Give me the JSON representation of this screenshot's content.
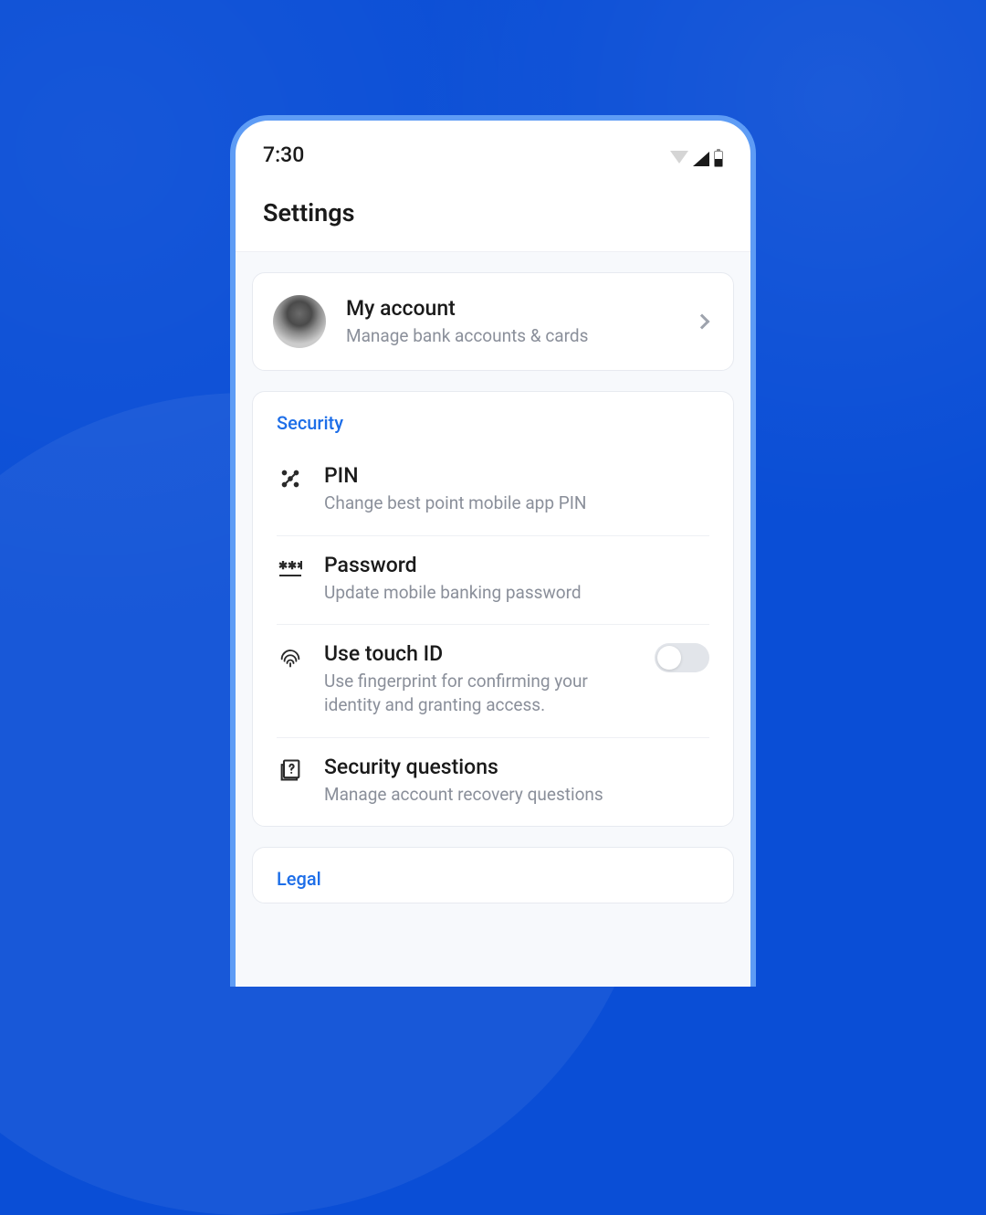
{
  "statusBar": {
    "time": "7:30"
  },
  "header": {
    "title": "Settings"
  },
  "account": {
    "title": "My account",
    "subtitle": "Manage bank accounts & cards"
  },
  "sections": {
    "security": {
      "header": "Security",
      "items": [
        {
          "title": "PIN",
          "subtitle": "Change best point mobile app PIN"
        },
        {
          "title": "Password",
          "subtitle": "Update mobile banking password"
        },
        {
          "title": "Use touch ID",
          "subtitle": "Use fingerprint for confirming your identity and granting access.",
          "toggle": false
        },
        {
          "title": "Security questions",
          "subtitle": "Manage account recovery questions"
        }
      ]
    },
    "legal": {
      "header": "Legal"
    }
  }
}
